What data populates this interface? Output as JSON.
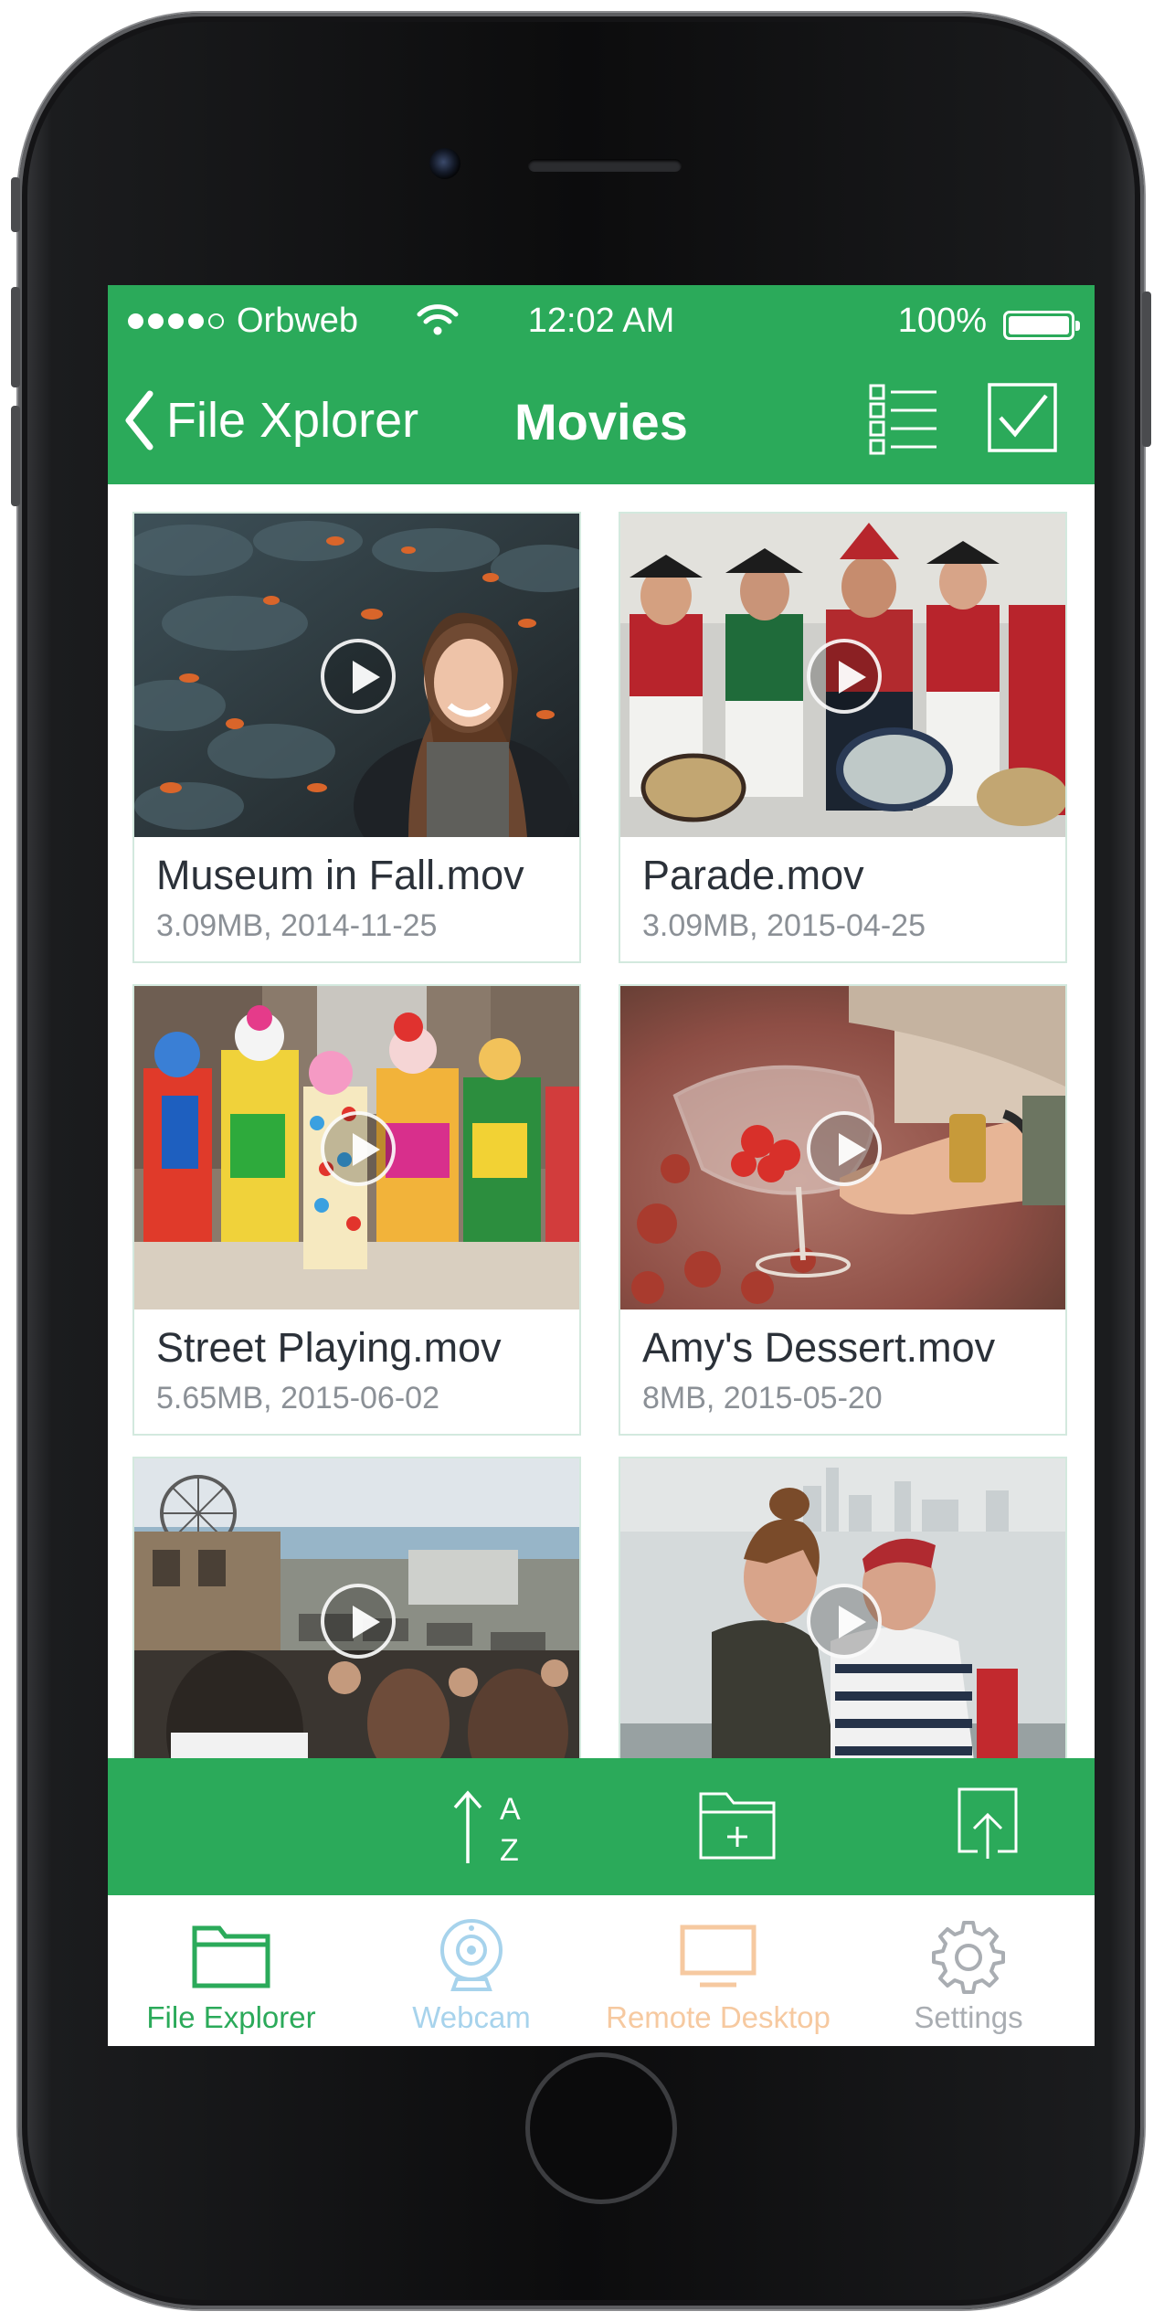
{
  "status_bar": {
    "carrier": "Orbweb",
    "time": "12:02 AM",
    "battery": "100%"
  },
  "nav": {
    "back_label": "File Xplorer",
    "title": "Movies"
  },
  "files": [
    {
      "name": "Museum in Fall.mov",
      "meta": "3.09MB, 2014-11-25"
    },
    {
      "name": "Parade.mov",
      "meta": "3.09MB, 2015-04-25"
    },
    {
      "name": "Street Playing.mov",
      "meta": "5.65MB, 2015-06-02"
    },
    {
      "name": "Amy's Dessert.mov",
      "meta": "8MB, 2015-05-20"
    },
    {
      "name": "",
      "meta": ""
    },
    {
      "name": "",
      "meta": ""
    }
  ],
  "action_bar": {
    "sort_icon": "sort-az-icon",
    "new_folder_icon": "new-folder-icon",
    "upload_icon": "upload-icon"
  },
  "tabs": [
    {
      "label": "File Explorer",
      "icon": "folder-icon",
      "color": "#2baa5a"
    },
    {
      "label": "Webcam",
      "icon": "webcam-icon",
      "color": "#a7d3ec"
    },
    {
      "label": "Remote Desktop",
      "icon": "monitor-icon",
      "color": "#f6c9a0"
    },
    {
      "label": "Settings",
      "icon": "gear-icon",
      "color": "#a9adb2"
    }
  ],
  "colors": {
    "brand_green": "#2baa5a"
  }
}
